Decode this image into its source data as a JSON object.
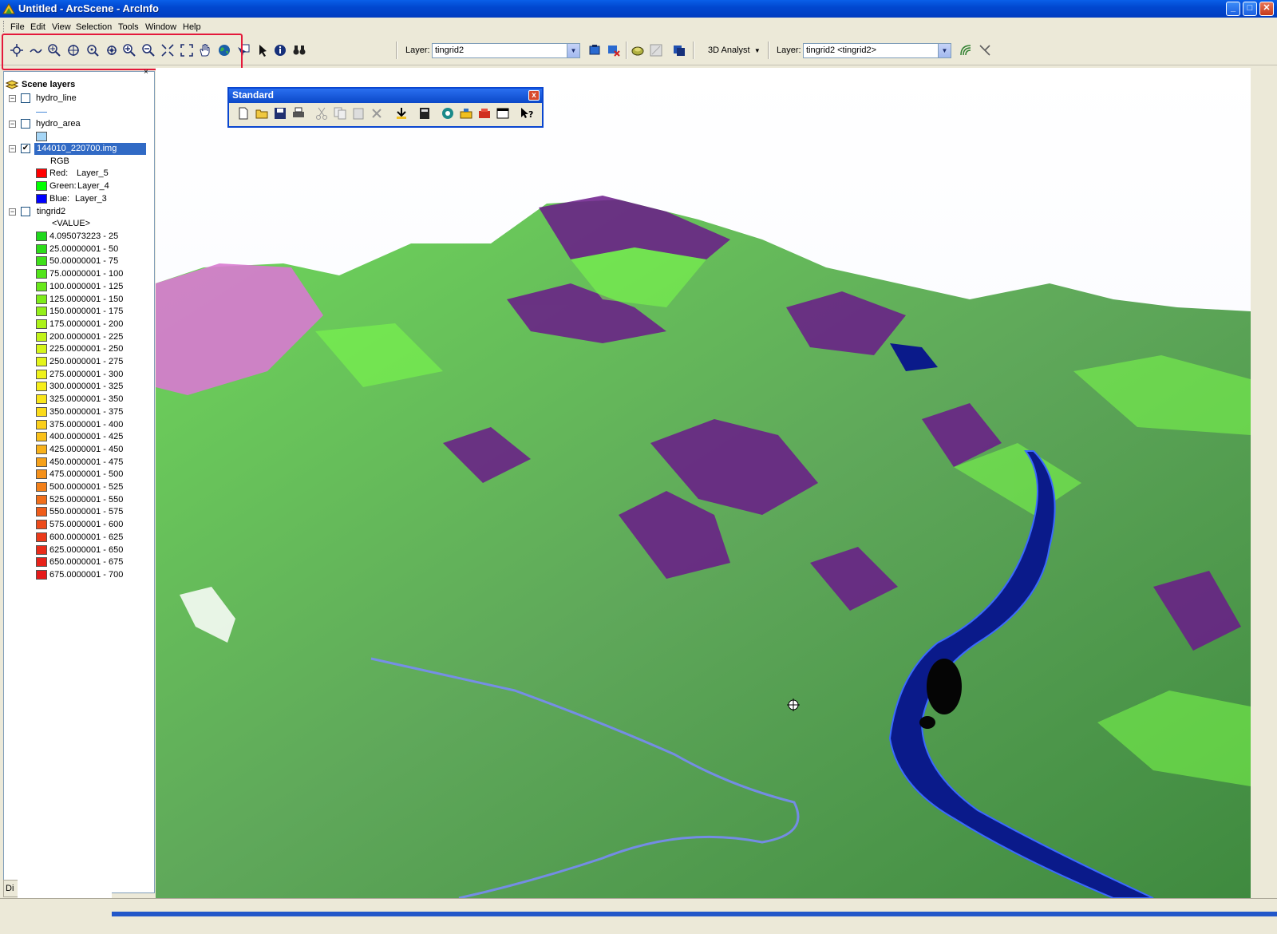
{
  "window": {
    "title": "Untitled - ArcScene - ArcInfo",
    "controls": {
      "minimize": "_",
      "maximize": "□",
      "close": "✕"
    }
  },
  "menu": [
    "File",
    "Edit",
    "View",
    "Selection",
    "Tools",
    "Window",
    "Help"
  ],
  "toolbar": {
    "nav_tools": [
      "navigate-icon",
      "fly-icon",
      "zoom-in-out-icon",
      "center-on-target-icon",
      "zoom-to-target-icon",
      "set-observer-icon",
      "zoom-in-icon",
      "zoom-out-icon",
      "fixed-zoom-in-icon",
      "full-extent-icon",
      "pan-hand-icon",
      "globe-icon",
      "select-features-icon",
      "select-elements-arrow-icon",
      "identify-icon",
      "find-binoculars-icon"
    ],
    "layer_label_1": "Layer:",
    "layer_value_1": "tingrid2",
    "analyst_label": "3D Analyst",
    "layer_label_2": "Layer:",
    "layer_value_2": "tingrid2 <tingrid2>"
  },
  "standard_toolbar": {
    "title": "Standard",
    "close": "x"
  },
  "toc": {
    "title": "Scene layers",
    "layers": [
      {
        "name": "hydro_line",
        "checked": false
      },
      {
        "name": "hydro_area",
        "checked": false
      },
      {
        "name": "144010_220700.img",
        "checked": true,
        "rgb_label": "RGB",
        "bands": [
          {
            "label": "Red:",
            "value": "Layer_5",
            "color": "#ff0000"
          },
          {
            "label": "Green:",
            "value": "Layer_4",
            "color": "#00ff00"
          },
          {
            "label": "Blue:",
            "value": "Layer_3",
            "color": "#0000ff"
          }
        ]
      },
      {
        "name": "tingrid2",
        "checked": false,
        "value_label": "<VALUE>"
      }
    ],
    "classes": [
      {
        "label": "4.095073223 - 25",
        "color": "#1fd81c"
      },
      {
        "label": "25.00000001 - 50",
        "color": "#2ddc1a"
      },
      {
        "label": "50.00000001 - 75",
        "color": "#3fe01a"
      },
      {
        "label": "75.00000001 - 100",
        "color": "#52e41a"
      },
      {
        "label": "100.0000001 - 125",
        "color": "#68e81a"
      },
      {
        "label": "125.0000001 - 150",
        "color": "#7eec1a"
      },
      {
        "label": "150.0000001 - 175",
        "color": "#95ef1a"
      },
      {
        "label": "175.0000001 - 200",
        "color": "#acf21a"
      },
      {
        "label": "200.0000001 - 225",
        "color": "#c2f41a"
      },
      {
        "label": "225.0000001 - 250",
        "color": "#d5f51a"
      },
      {
        "label": "250.0000001 - 275",
        "color": "#e4f41a"
      },
      {
        "label": "275.0000001 - 300",
        "color": "#eff21a"
      },
      {
        "label": "300.0000001 - 325",
        "color": "#f6ee1a"
      },
      {
        "label": "325.0000001 - 350",
        "color": "#f9e51a"
      },
      {
        "label": "350.0000001 - 375",
        "color": "#fbdb1a"
      },
      {
        "label": "375.0000001 - 400",
        "color": "#fbcf1a"
      },
      {
        "label": "400.0000001 - 425",
        "color": "#fac11a"
      },
      {
        "label": "425.0000001 - 450",
        "color": "#f8b11a"
      },
      {
        "label": "450.0000001 - 475",
        "color": "#f6a11a"
      },
      {
        "label": "475.0000001 - 500",
        "color": "#f5911a"
      },
      {
        "label": "500.0000001 - 525",
        "color": "#f3801a"
      },
      {
        "label": "525.0000001 - 550",
        "color": "#f16e1a"
      },
      {
        "label": "550.0000001 - 575",
        "color": "#ef5c1a"
      },
      {
        "label": "575.0000001 - 600",
        "color": "#ed4a1a"
      },
      {
        "label": "600.0000001 - 625",
        "color": "#eb3a1a"
      },
      {
        "label": "625.0000001 - 650",
        "color": "#e92c1a"
      },
      {
        "label": "650.0000001 - 675",
        "color": "#e7221a"
      },
      {
        "label": "675.0000001 - 700",
        "color": "#e51a1a"
      }
    ],
    "bottom_tab": "Di"
  }
}
